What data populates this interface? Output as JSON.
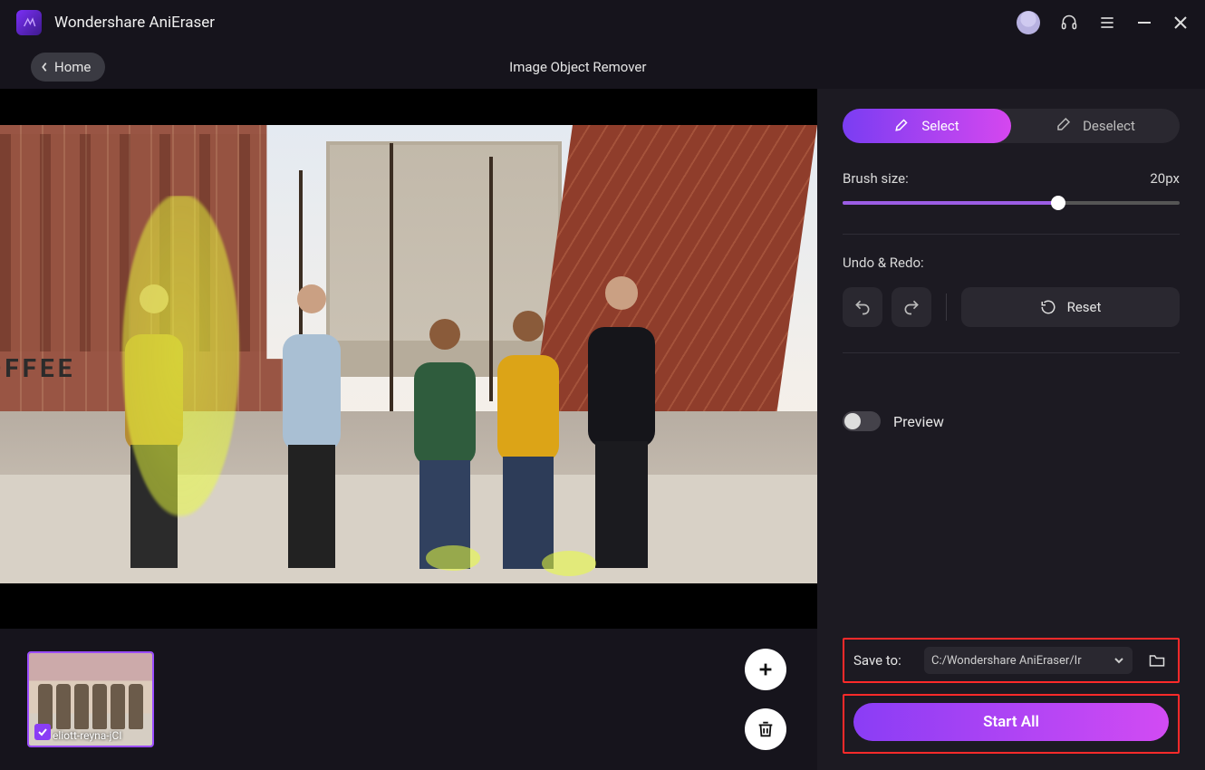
{
  "app": {
    "title": "Wondershare AniEraser"
  },
  "nav": {
    "home_label": "Home",
    "page_title": "Image Object Remover"
  },
  "panel": {
    "select_label": "Select",
    "deselect_label": "Deselect",
    "brush_label": "Brush size:",
    "brush_value": "20px",
    "undo_redo_label": "Undo & Redo:",
    "reset_label": "Reset",
    "preview_label": "Preview",
    "save_to_label": "Save to:",
    "save_path": "C:/Wondershare AniEraser/Ir",
    "start_label": "Start All"
  },
  "thumbnail": {
    "filename": "eliott-reyna-jCI"
  }
}
